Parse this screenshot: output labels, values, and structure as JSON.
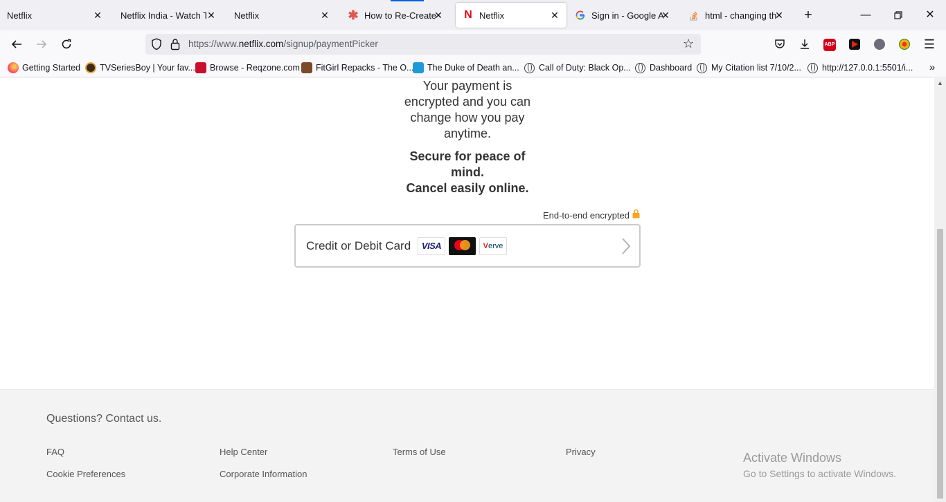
{
  "browser": {
    "tabs": [
      {
        "title": "Netflix",
        "icon": "none"
      },
      {
        "title": "Netflix India - Watch TV",
        "icon": "none"
      },
      {
        "title": "Netflix",
        "icon": "none"
      },
      {
        "title": "How to Re-Create a",
        "icon": "asterisk-icon"
      },
      {
        "title": "Netflix",
        "icon": "netflix-n-icon",
        "active": true
      },
      {
        "title": "Sign in - Google Acc",
        "icon": "google-g-icon"
      },
      {
        "title": "html - changing the",
        "icon": "stackoverflow-icon"
      }
    ],
    "close_glyph": "✕",
    "new_tab_glyph": "+",
    "url": {
      "prefix": "https://www.",
      "domain": "netflix.com",
      "path": "/signup/paymentPicker"
    },
    "abp_badge_count": "7",
    "abp_label": "ABP"
  },
  "bookmarks": [
    {
      "label": "Getting Started",
      "icon": "firefox-icon",
      "color": "#e66000"
    },
    {
      "label": "TVSeriesBoy | Your fav...",
      "icon": "tvseriesboy-icon",
      "color": "#3b2b1b"
    },
    {
      "label": "Browse - Reqzone.com",
      "icon": "reqzone-icon",
      "color": "#c8102e"
    },
    {
      "label": "FitGirl Repacks - The O...",
      "icon": "fitgirl-icon",
      "color": "#7a4a2a"
    },
    {
      "label": "The Duke of Death an...",
      "icon": "mk-icon",
      "color": "#1e9bd7"
    },
    {
      "label": "Call of Duty: Black Op...",
      "icon": "globe-icon"
    },
    {
      "label": "Dashboard",
      "icon": "globe-icon"
    },
    {
      "label": "My Citation list 7/10/2...",
      "icon": "globe-icon"
    },
    {
      "label": "http://127.0.0.1:5501/i...",
      "icon": "globe-icon"
    }
  ],
  "page": {
    "payment_message": "Your payment is encrypted and you can change how you pay anytime.",
    "secure_line1": "Secure for peace of mind.",
    "secure_line2": "Cancel easily online.",
    "e2e_label": "End-to-end encrypted",
    "card_option_label": "Credit or Debit Card",
    "logos": {
      "visa": "VISA",
      "verve_v": "V",
      "verve_rest": "erve"
    }
  },
  "footer": {
    "contact": "Questions? Contact us.",
    "links": {
      "faq": "FAQ",
      "help_center": "Help Center",
      "terms": "Terms of Use",
      "privacy": "Privacy",
      "cookie_prefs": "Cookie Preferences",
      "corporate": "Corporate Information"
    }
  },
  "watermark": {
    "title": "Activate Windows",
    "subtitle": "Go to Settings to activate Windows."
  },
  "colors": {
    "netflix_red": "#e50914",
    "lock_gold": "#f5a623",
    "accent_blue": "#0060df"
  }
}
